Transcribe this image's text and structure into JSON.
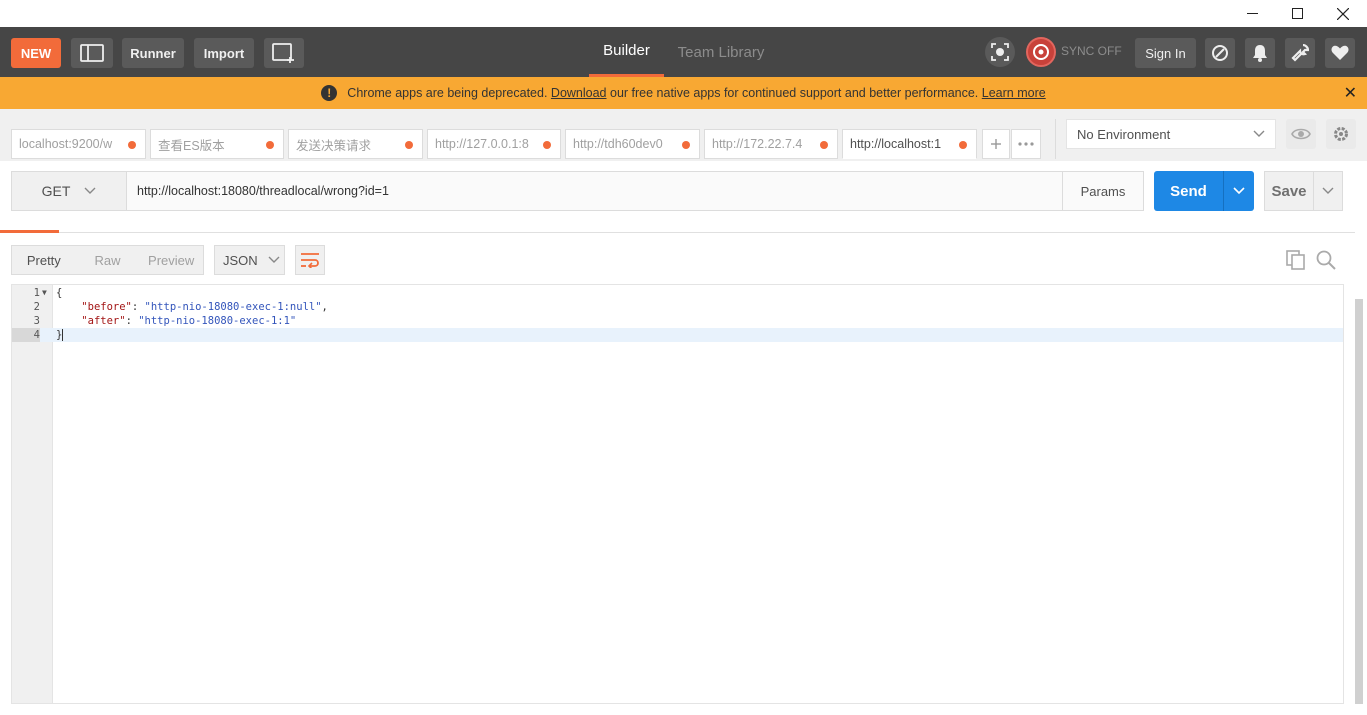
{
  "window": {
    "min": "─",
    "max": "☐",
    "close": "✕"
  },
  "header": {
    "new_label": "NEW",
    "runner_label": "Runner",
    "import_label": "Import",
    "tabs": [
      {
        "label": "Builder"
      },
      {
        "label": "Team Library"
      }
    ],
    "sync_label": "SYNC OFF",
    "signin_label": "Sign In",
    "accent": "#f26b3a"
  },
  "banner": {
    "text_before": "Chrome apps are being deprecated.",
    "download_link": "Download",
    "text_middle": "our free native apps for continued support and better performance.",
    "learn_more_link": "Learn more",
    "close": "✕",
    "color": "#f8a833"
  },
  "request_tabs": [
    {
      "label": "localhost:9200/w"
    },
    {
      "label": "查看ES版本"
    },
    {
      "label": "发送决策请求"
    },
    {
      "label": "http://127.0.0.1:8"
    },
    {
      "label": "http://tdh60dev0"
    },
    {
      "label": "http://172.22.7.4"
    },
    {
      "label": "http://localhost:1"
    }
  ],
  "environment": {
    "selected": "No Environment"
  },
  "request": {
    "method": "GET",
    "url": "http://localhost:18080/threadlocal/wrong?id=1",
    "params_label": "Params",
    "send_label": "Send",
    "save_label": "Save",
    "send_color": "#1e88e5"
  },
  "response": {
    "formats": [
      {
        "label": "Pretty"
      },
      {
        "label": "Raw"
      },
      {
        "label": "Preview"
      }
    ],
    "language": "JSON",
    "lines": [
      {
        "num": "1",
        "open": "{"
      },
      {
        "num": "2",
        "key": "\"before\"",
        "sep": ": ",
        "value": "\"http-nio-18080-exec-1:null\"",
        "end": ","
      },
      {
        "num": "3",
        "key": "\"after\"",
        "sep": ": ",
        "value": "\"http-nio-18080-exec-1:1\"",
        "end": ""
      },
      {
        "num": "4",
        "close": "}"
      }
    ]
  }
}
